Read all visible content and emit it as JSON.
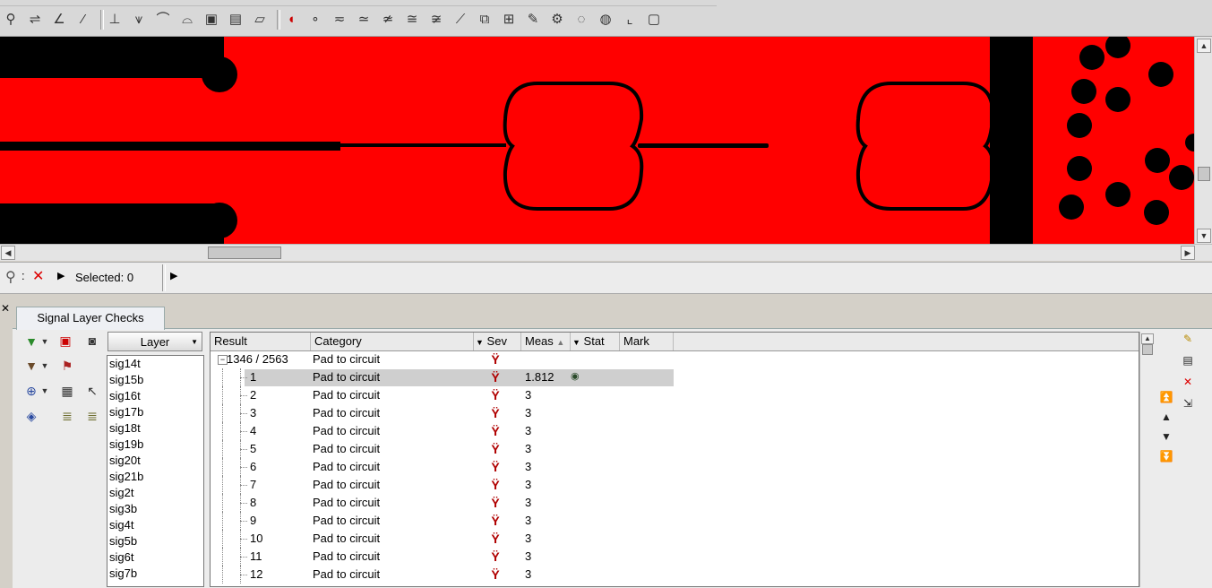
{
  "toolbar": {
    "icons": [
      "route-icon",
      "trace-icon",
      "angle-icon",
      "slash-icon",
      "pin-icon",
      "via-icon",
      "arc-icon",
      "arc2-icon",
      "pad-icon",
      "pad2-icon",
      "shape-icon",
      "magnet-icon",
      "dim1-icon",
      "dim2-icon",
      "dim3-icon",
      "dim4-icon",
      "dim5-icon",
      "dim6-icon",
      "brush-icon",
      "copy-icon",
      "frame-icon",
      "pencil-frame-icon",
      "tools-icon",
      "rotate1-icon",
      "rotate2-icon",
      "corner-icon",
      "box-icon"
    ]
  },
  "status": {
    "selected_label": "Selected: 0",
    "filter_icon": "filter-icon",
    "clear_icon": "x-icon"
  },
  "panel": {
    "tab_label": "Signal Layer Checks",
    "close_label": "✕",
    "layer_header": "Layer",
    "layers": [
      "sig14t",
      "sig15b",
      "sig16t",
      "sig17b",
      "sig18t",
      "sig19b",
      "sig20t",
      "sig21b",
      "sig2t",
      "sig3b",
      "sig4t",
      "sig5b",
      "sig6t",
      "sig7b"
    ]
  },
  "grid": {
    "headers": {
      "result": "Result",
      "category": "Category",
      "sev": "Sev",
      "meas": "Meas",
      "stat": "Stat",
      "mark": "Mark"
    },
    "group": {
      "result": "1346 / 2563",
      "category": "Pad to circuit"
    },
    "rows": [
      {
        "result": "1",
        "category": "Pad to circuit",
        "meas": "1.812",
        "stat": true,
        "selected": true
      },
      {
        "result": "2",
        "category": "Pad to circuit",
        "meas": "3"
      },
      {
        "result": "3",
        "category": "Pad to circuit",
        "meas": "3"
      },
      {
        "result": "4",
        "category": "Pad to circuit",
        "meas": "3"
      },
      {
        "result": "5",
        "category": "Pad to circuit",
        "meas": "3"
      },
      {
        "result": "6",
        "category": "Pad to circuit",
        "meas": "3"
      },
      {
        "result": "7",
        "category": "Pad to circuit",
        "meas": "3"
      },
      {
        "result": "8",
        "category": "Pad to circuit",
        "meas": "3"
      },
      {
        "result": "9",
        "category": "Pad to circuit",
        "meas": "3"
      },
      {
        "result": "10",
        "category": "Pad to circuit",
        "meas": "3"
      },
      {
        "result": "11",
        "category": "Pad to circuit",
        "meas": "3"
      },
      {
        "result": "12",
        "category": "Pad to circuit",
        "meas": "3"
      }
    ]
  },
  "colors": {
    "canvas_bg": "#ff0000",
    "copper": "#000000",
    "severity": "#b00000"
  }
}
